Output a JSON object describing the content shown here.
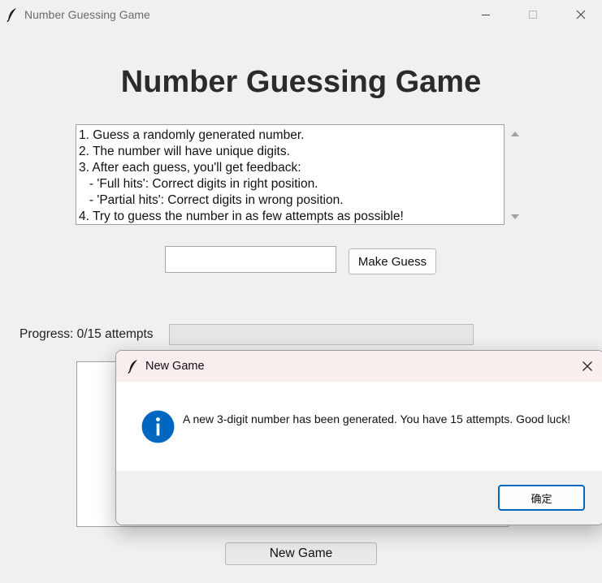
{
  "window": {
    "title": "Number Guessing Game",
    "icon": "feather-icon"
  },
  "main": {
    "heading": "Number Guessing Game",
    "instructions": [
      "1. Guess a randomly generated number.",
      "2. The number will have unique digits.",
      "3. After each guess, you'll get feedback:",
      "   - 'Full hits': Correct digits in right position.",
      "   - 'Partial hits': Correct digits in wrong position.",
      "4. Try to guess the number in as few attempts as possible!"
    ],
    "guess_input": {
      "value": "",
      "placeholder": ""
    },
    "make_guess_label": "Make Guess",
    "progress_label": "Progress: 0/15 attempts",
    "progress_fraction": 0,
    "new_game_label": "New Game"
  },
  "dialog": {
    "title": "New Game",
    "message": "A new 3-digit number has been generated. You have 15 attempts. Good luck!",
    "ok_label": "确定",
    "icon": "info-icon"
  },
  "colors": {
    "dialog_titlebar": "#f9eeee",
    "info_blue": "#0067c0",
    "ok_border": "#0067c0"
  }
}
